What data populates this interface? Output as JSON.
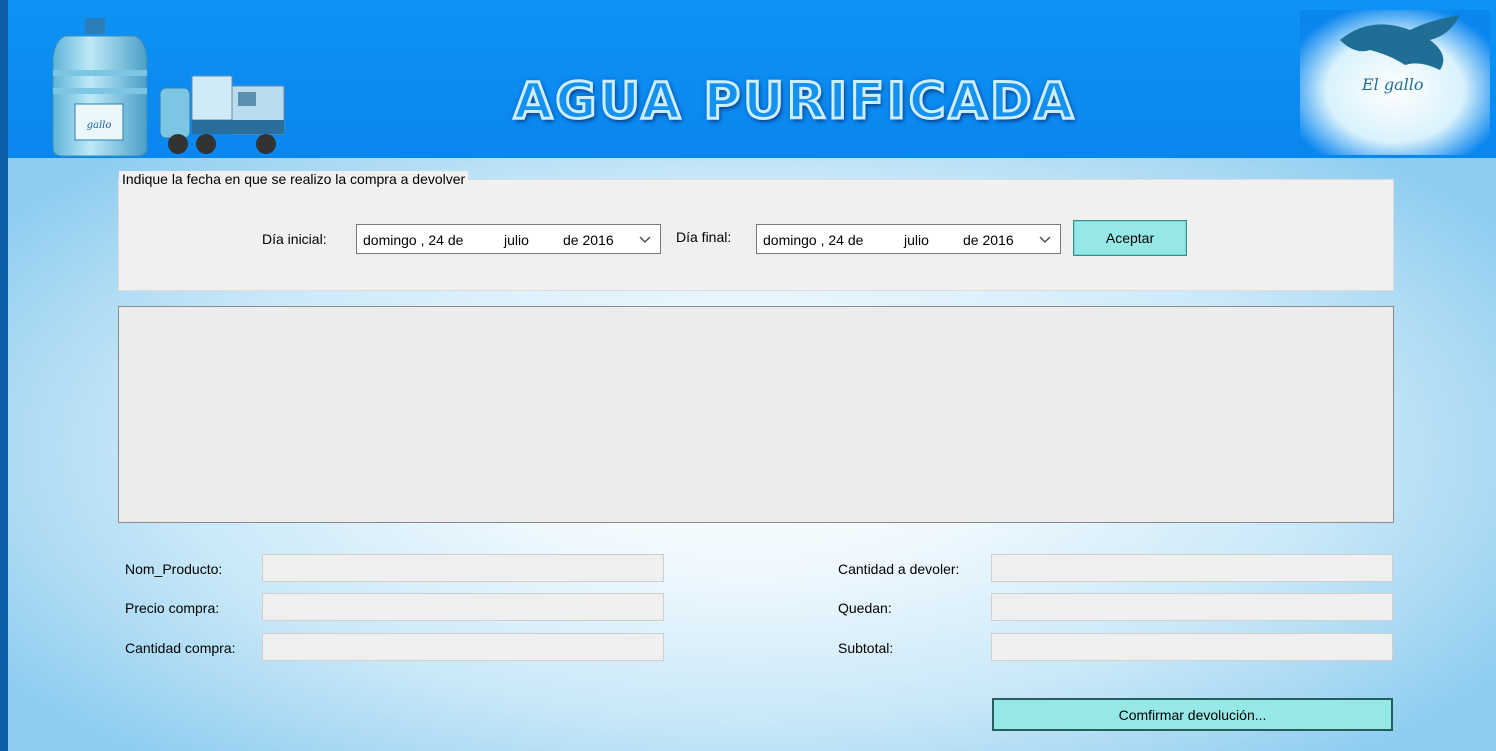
{
  "header": {
    "title": "AGUA PURIFICADA",
    "logo_text": "El gallo",
    "bottle_label": "gallo"
  },
  "date_group": {
    "legend": "Indique la fecha en que se realizo la compra a devolver",
    "start_label": "Día inicial:",
    "end_label": "Día final:",
    "start_date": {
      "weekday": "domingo , 24 de",
      "month": "julio",
      "year": "de 2016"
    },
    "end_date": {
      "weekday": "domingo , 24 de",
      "month": "julio",
      "year": "de 2016"
    },
    "accept_button": "Aceptar"
  },
  "form": {
    "left": [
      {
        "label": "Nom_Producto:",
        "value": ""
      },
      {
        "label": "Precio compra:",
        "value": ""
      },
      {
        "label": "Cantidad compra:",
        "value": ""
      }
    ],
    "right": [
      {
        "label": "Cantidad a devoler:",
        "value": ""
      },
      {
        "label": "Quedan:",
        "value": ""
      },
      {
        "label": "Subtotal:",
        "value": ""
      }
    ]
  },
  "confirm_button": "Comfirmar devolución...",
  "colors": {
    "header_blue": "#0a8cf2",
    "button_cyan": "#95e8e6",
    "frame_blue": "#0e5fa8"
  }
}
